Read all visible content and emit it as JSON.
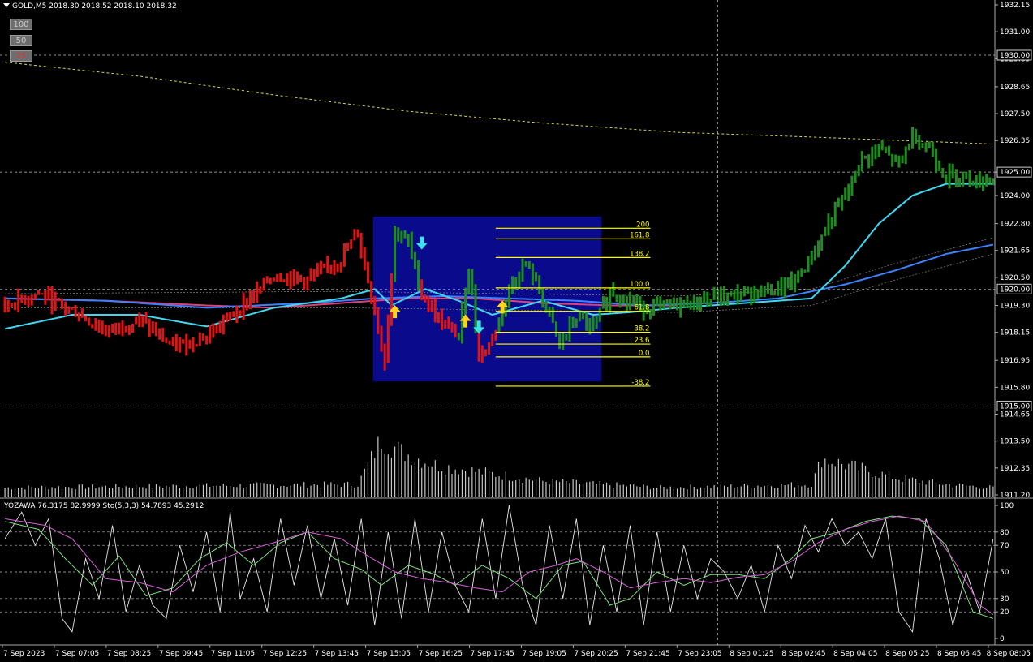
{
  "header": {
    "symbol": "GOLD,M5",
    "ohlc": "2018.30 2018.52 2018.10 2018.32"
  },
  "zoom_buttons": [
    {
      "label": "100",
      "color": "#c8c8c8"
    },
    {
      "label": "50",
      "color": "#c8c8c8"
    },
    {
      "label": "25",
      "color": "#e03030"
    }
  ],
  "indicator_header": {
    "yozawa": "YOZAWA 76.3175 82.9999",
    "stoch": "Sto(5,3,3) 54.7893 45.2912"
  },
  "colors": {
    "background": "#000000",
    "bull_bar": "#1f8c1f",
    "bear_bar": "#e01414",
    "fib_box": "#0a0a8c",
    "fib_line": "#ffff00",
    "ma_cyan": "#40d8f0",
    "ma_blue": "#3c82ff",
    "ma_pink": "#e0407a",
    "ma_yellow": "#d8d840",
    "up_arrow": "#ffd21e",
    "down_arrow": "#3ce0e8",
    "volume": "#c8c8c8"
  },
  "chart_data": {
    "type": "candlestick",
    "main_axis": {
      "ylim": [
        1911.2,
        1932.15
      ],
      "tick_labels": [
        "1932.15",
        "1931.00",
        "1929.85",
        "1928.65",
        "1927.50",
        "1926.35",
        "1925.00",
        "1924.00",
        "1922.80",
        "1921.65",
        "1920.50",
        "1919.30",
        "1918.15",
        "1916.95",
        "1915.80",
        "1914.65",
        "1913.50",
        "1912.35",
        "1911.20"
      ],
      "tick_values": [
        1932.15,
        1931.0,
        1929.85,
        1928.65,
        1927.5,
        1926.35,
        1925.0,
        1924.0,
        1922.8,
        1921.65,
        1920.5,
        1919.3,
        1918.15,
        1916.95,
        1915.8,
        1914.65,
        1913.5,
        1912.35,
        1911.2
      ],
      "price_marks": [
        {
          "value": 1930.0,
          "label": "1930.00"
        },
        {
          "value": 1925.0,
          "label": "1925.00"
        },
        {
          "value": 1920.0,
          "label": "1920.00"
        },
        {
          "value": 1915.0,
          "label": "1915.00"
        }
      ]
    },
    "x_labels": [
      "7 Sep 2023",
      "7 Sep 07:05",
      "7 Sep 08:25",
      "7 Sep 09:45",
      "7 Sep 11:05",
      "7 Sep 12:25",
      "7 Sep 13:45",
      "7 Sep 15:05",
      "7 Sep 16:25",
      "7 Sep 17:45",
      "7 Sep 19:05",
      "7 Sep 20:25",
      "7 Sep 21:45",
      "7 Sep 23:05",
      "8 Sep 01:25",
      "8 Sep 02:45",
      "8 Sep 04:05",
      "8 Sep 05:25",
      "8 Sep 06:45",
      "8 Sep 08:05"
    ],
    "price_keypoints": [
      [
        0,
        1919.3
      ],
      [
        10,
        1919.8
      ],
      [
        20,
        1919.1
      ],
      [
        30,
        1918.2
      ],
      [
        40,
        1918.7
      ],
      [
        50,
        1917.5
      ],
      [
        60,
        1918.0
      ],
      [
        70,
        1919.2
      ],
      [
        80,
        1920.6
      ],
      [
        90,
        1920.4
      ],
      [
        100,
        1921.3
      ],
      [
        105,
        1922.4
      ],
      [
        110,
        1919.0
      ],
      [
        113,
        1917.0
      ],
      [
        116,
        1922.5
      ],
      [
        120,
        1922.0
      ],
      [
        124,
        1919.8
      ],
      [
        130,
        1918.5
      ],
      [
        135,
        1918.0
      ],
      [
        138,
        1921.0
      ],
      [
        141,
        1917.2
      ],
      [
        145,
        1917.8
      ],
      [
        150,
        1920.0
      ],
      [
        155,
        1921.1
      ],
      [
        160,
        1919.6
      ],
      [
        165,
        1917.6
      ],
      [
        170,
        1918.8
      ],
      [
        175,
        1918.3
      ],
      [
        180,
        1919.9
      ],
      [
        190,
        1919.2
      ],
      [
        200,
        1919.3
      ],
      [
        210,
        1919.6
      ],
      [
        220,
        1919.8
      ],
      [
        230,
        1920.0
      ],
      [
        235,
        1920.3
      ],
      [
        240,
        1921.4
      ],
      [
        245,
        1922.8
      ],
      [
        250,
        1924.0
      ],
      [
        255,
        1925.5
      ],
      [
        260,
        1926.0
      ],
      [
        266,
        1925.3
      ],
      [
        270,
        1926.6
      ],
      [
        275,
        1926.0
      ],
      [
        280,
        1924.8
      ],
      [
        285,
        1924.9
      ],
      [
        290,
        1924.6
      ],
      [
        294,
        1924.8
      ]
    ],
    "bull_ranges": [
      [
        116,
        123
      ],
      [
        135,
        140
      ],
      [
        147,
        294
      ]
    ],
    "ma_cyan": [
      [
        0,
        1918.3
      ],
      [
        20,
        1918.9
      ],
      [
        40,
        1918.9
      ],
      [
        60,
        1918.4
      ],
      [
        80,
        1919.2
      ],
      [
        100,
        1919.6
      ],
      [
        110,
        1920.0
      ],
      [
        115,
        1919.3
      ],
      [
        125,
        1920.0
      ],
      [
        135,
        1919.5
      ],
      [
        145,
        1918.9
      ],
      [
        160,
        1919.5
      ],
      [
        175,
        1918.9
      ],
      [
        185,
        1919.0
      ],
      [
        200,
        1919.2
      ],
      [
        220,
        1919.4
      ],
      [
        240,
        1919.6
      ],
      [
        250,
        1921.0
      ],
      [
        260,
        1922.8
      ],
      [
        270,
        1924.0
      ],
      [
        280,
        1924.5
      ],
      [
        294,
        1924.5
      ]
    ],
    "ma_blue": [
      [
        0,
        1919.6
      ],
      [
        30,
        1919.5
      ],
      [
        60,
        1919.2
      ],
      [
        90,
        1919.4
      ],
      [
        110,
        1919.6
      ],
      [
        130,
        1919.7
      ],
      [
        150,
        1919.6
      ],
      [
        170,
        1919.5
      ],
      [
        190,
        1919.3
      ],
      [
        210,
        1919.4
      ],
      [
        230,
        1919.6
      ],
      [
        250,
        1920.2
      ],
      [
        265,
        1920.8
      ],
      [
        280,
        1921.5
      ],
      [
        294,
        1921.9
      ]
    ],
    "ma_pink": [
      [
        0,
        1919.6
      ],
      [
        30,
        1919.5
      ],
      [
        60,
        1919.3
      ],
      [
        80,
        1919.2
      ],
      [
        100,
        1919.4
      ],
      [
        120,
        1919.6
      ],
      [
        140,
        1919.6
      ],
      [
        160,
        1919.4
      ],
      [
        180,
        1919.3
      ],
      [
        200,
        1919.3
      ]
    ],
    "ma_yellow_dotted": [
      [
        0,
        1929.7
      ],
      [
        40,
        1929.1
      ],
      [
        80,
        1928.3
      ],
      [
        120,
        1927.6
      ],
      [
        160,
        1927.1
      ],
      [
        200,
        1926.7
      ],
      [
        240,
        1926.5
      ],
      [
        294,
        1926.2
      ]
    ],
    "envelope_upper": [
      [
        0,
        1919.8
      ],
      [
        100,
        1919.9
      ],
      [
        200,
        1919.7
      ],
      [
        240,
        1920.0
      ],
      [
        265,
        1921.1
      ],
      [
        294,
        1922.2
      ]
    ],
    "envelope_lower": [
      [
        0,
        1919.2
      ],
      [
        100,
        1919.2
      ],
      [
        200,
        1919.0
      ],
      [
        240,
        1919.3
      ],
      [
        265,
        1920.4
      ],
      [
        294,
        1921.5
      ]
    ],
    "fibonacci": {
      "levels": [
        {
          "label": "200",
          "value": 1922.6
        },
        {
          "label": "161.8",
          "value": 1922.15
        },
        {
          "label": "138.2",
          "value": 1921.35
        },
        {
          "label": "100.0",
          "value": 1920.05
        },
        {
          "label": "61.8",
          "value": 1919.05
        },
        {
          "label": "38.2",
          "value": 1918.15
        },
        {
          "label": "23.6",
          "value": 1917.65
        },
        {
          "label": "0.0",
          "value": 1917.1
        },
        {
          "label": "-38.2",
          "value": 1915.85
        }
      ],
      "box_bars": [
        110,
        178
      ],
      "box_prices": [
        1916.05,
        1923.1
      ],
      "line_bars": [
        146,
        192
      ]
    },
    "arrows": [
      {
        "dir": "up",
        "bar": 116,
        "price": 1919.0
      },
      {
        "dir": "down",
        "bar": 124,
        "price": 1922.0
      },
      {
        "dir": "up",
        "bar": 137,
        "price": 1918.6
      },
      {
        "dir": "down",
        "bar": 141,
        "price": 1918.4
      },
      {
        "dir": "up",
        "bar": 148,
        "price": 1919.2
      }
    ],
    "volume_profile": [
      [
        0,
        3
      ],
      [
        105,
        4
      ],
      [
        112,
        18
      ],
      [
        118,
        14
      ],
      [
        128,
        10
      ],
      [
        140,
        8
      ],
      [
        160,
        5
      ],
      [
        195,
        3
      ],
      [
        240,
        4
      ],
      [
        243,
        12
      ],
      [
        250,
        10
      ],
      [
        265,
        6
      ],
      [
        280,
        4
      ],
      [
        294,
        3
      ]
    ],
    "oscillator": {
      "ylim": [
        0,
        100
      ],
      "tick_labels": [
        "100",
        "80",
        "70",
        "50",
        "30",
        "20",
        "0"
      ],
      "tick_values": [
        100,
        80,
        70,
        50,
        30,
        20,
        0
      ],
      "level_lines": [
        80,
        70,
        50,
        30,
        20
      ],
      "white_series": [
        [
          0,
          75
        ],
        [
          5,
          95
        ],
        [
          9,
          70
        ],
        [
          13,
          90
        ],
        [
          17,
          15
        ],
        [
          20,
          5
        ],
        [
          24,
          60
        ],
        [
          28,
          30
        ],
        [
          32,
          85
        ],
        [
          36,
          20
        ],
        [
          40,
          55
        ],
        [
          44,
          25
        ],
        [
          48,
          15
        ],
        [
          52,
          70
        ],
        [
          56,
          35
        ],
        [
          60,
          80
        ],
        [
          64,
          20
        ],
        [
          67,
          95
        ],
        [
          70,
          30
        ],
        [
          74,
          60
        ],
        [
          78,
          20
        ],
        [
          82,
          90
        ],
        [
          86,
          40
        ],
        [
          90,
          85
        ],
        [
          94,
          30
        ],
        [
          98,
          75
        ],
        [
          102,
          25
        ],
        [
          106,
          90
        ],
        [
          110,
          10
        ],
        [
          114,
          80
        ],
        [
          118,
          15
        ],
        [
          122,
          90
        ],
        [
          126,
          20
        ],
        [
          130,
          80
        ],
        [
          134,
          40
        ],
        [
          138,
          20
        ],
        [
          142,
          90
        ],
        [
          146,
          30
        ],
        [
          150,
          100
        ],
        [
          154,
          40
        ],
        [
          158,
          10
        ],
        [
          162,
          85
        ],
        [
          166,
          30
        ],
        [
          170,
          90
        ],
        [
          174,
          10
        ],
        [
          178,
          70
        ],
        [
          182,
          20
        ],
        [
          186,
          85
        ],
        [
          190,
          10
        ],
        [
          194,
          80
        ],
        [
          198,
          20
        ],
        [
          202,
          70
        ],
        [
          206,
          30
        ],
        [
          210,
          60
        ],
        [
          214,
          50
        ],
        [
          218,
          30
        ],
        [
          222,
          55
        ],
        [
          226,
          20
        ],
        [
          230,
          70
        ],
        [
          234,
          45
        ],
        [
          238,
          85
        ],
        [
          242,
          65
        ],
        [
          246,
          90
        ],
        [
          250,
          70
        ],
        [
          254,
          80
        ],
        [
          258,
          60
        ],
        [
          262,
          90
        ],
        [
          266,
          20
        ],
        [
          270,
          5
        ],
        [
          274,
          90
        ],
        [
          278,
          60
        ],
        [
          282,
          10
        ],
        [
          286,
          50
        ],
        [
          290,
          20
        ],
        [
          294,
          75
        ]
      ],
      "green_series": [
        [
          0,
          88
        ],
        [
          10,
          82
        ],
        [
          18,
          60
        ],
        [
          26,
          40
        ],
        [
          34,
          62
        ],
        [
          42,
          32
        ],
        [
          50,
          38
        ],
        [
          58,
          60
        ],
        [
          66,
          72
        ],
        [
          74,
          55
        ],
        [
          82,
          72
        ],
        [
          90,
          80
        ],
        [
          98,
          60
        ],
        [
          106,
          52
        ],
        [
          112,
          40
        ],
        [
          120,
          55
        ],
        [
          128,
          48
        ],
        [
          134,
          40
        ],
        [
          142,
          55
        ],
        [
          150,
          45
        ],
        [
          158,
          30
        ],
        [
          166,
          55
        ],
        [
          172,
          58
        ],
        [
          180,
          25
        ],
        [
          186,
          30
        ],
        [
          194,
          50
        ],
        [
          202,
          40
        ],
        [
          210,
          48
        ],
        [
          218,
          48
        ],
        [
          226,
          45
        ],
        [
          234,
          60
        ],
        [
          240,
          75
        ],
        [
          248,
          80
        ],
        [
          256,
          88
        ],
        [
          264,
          92
        ],
        [
          272,
          90
        ],
        [
          280,
          70
        ],
        [
          288,
          20
        ],
        [
          294,
          15
        ]
      ],
      "magenta_series": [
        [
          0,
          90
        ],
        [
          12,
          85
        ],
        [
          20,
          75
        ],
        [
          30,
          45
        ],
        [
          40,
          42
        ],
        [
          50,
          35
        ],
        [
          60,
          55
        ],
        [
          70,
          65
        ],
        [
          80,
          72
        ],
        [
          90,
          80
        ],
        [
          100,
          75
        ],
        [
          108,
          62
        ],
        [
          116,
          50
        ],
        [
          124,
          45
        ],
        [
          132,
          42
        ],
        [
          140,
          38
        ],
        [
          148,
          35
        ],
        [
          156,
          50
        ],
        [
          164,
          55
        ],
        [
          170,
          60
        ],
        [
          178,
          50
        ],
        [
          186,
          38
        ],
        [
          194,
          42
        ],
        [
          202,
          45
        ],
        [
          210,
          42
        ],
        [
          218,
          46
        ],
        [
          226,
          48
        ],
        [
          234,
          58
        ],
        [
          242,
          72
        ],
        [
          250,
          82
        ],
        [
          258,
          88
        ],
        [
          266,
          92
        ],
        [
          274,
          88
        ],
        [
          282,
          60
        ],
        [
          290,
          25
        ],
        [
          294,
          18
        ]
      ]
    },
    "cursor_bar": 212
  }
}
